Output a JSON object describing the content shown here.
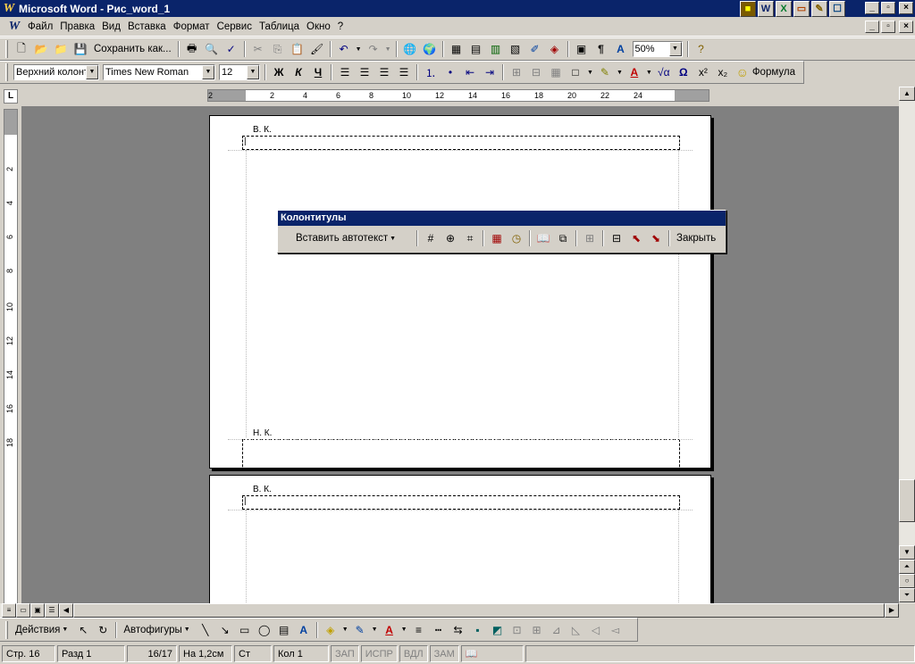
{
  "window": {
    "title": "Microsoft Word - Рис_word_1",
    "min": "_",
    "max": "🗗",
    "close": "×"
  },
  "tray": [
    {
      "name": "word-tray-icon",
      "glyph": "W"
    },
    {
      "name": "excel-tray-icon",
      "glyph": "X"
    },
    {
      "name": "powerpoint-tray-icon",
      "glyph": "▭"
    },
    {
      "name": "access-tray-icon",
      "glyph": "🔑"
    },
    {
      "name": "outlook-tray-icon",
      "glyph": "✉"
    }
  ],
  "menu": [
    "Файл",
    "Правка",
    "Вид",
    "Вставка",
    "Формат",
    "Сервис",
    "Таблица",
    "Окно",
    "?"
  ],
  "standard_toolbar": {
    "save_as_label": "Сохранить как...",
    "zoom": "50%"
  },
  "format_toolbar": {
    "style": "Верхний колонт",
    "font": "Times New Roman",
    "size": "12",
    "bold": "Ж",
    "italic": "К",
    "underline": "Ч",
    "omega": "Ω",
    "superscript": "x²",
    "subscript": "x₂",
    "formula_label": "Формула"
  },
  "ruler": {
    "h_labels": [
      "2",
      "2",
      "4",
      "6",
      "8",
      "10",
      "12",
      "14",
      "16",
      "18",
      "20",
      "22",
      "24"
    ],
    "v_labels": [
      "2",
      "4",
      "6",
      "8",
      "10",
      "12",
      "14",
      "16",
      "18"
    ]
  },
  "document": {
    "header_label": "В. К.",
    "footer_label": "Н. К."
  },
  "hf_toolbar": {
    "title": "Колонтитулы",
    "insert_autotext": "Вставить автотекст",
    "close": "Закрыть"
  },
  "draw_toolbar": {
    "actions": "Действия",
    "autoshapes": "Автофигуры"
  },
  "status": {
    "page": "Стр. 16",
    "section": "Разд 1",
    "pages": "16/17",
    "at": "На 1,2см",
    "line": "Ст",
    "col": "Кол 1",
    "rec": "ЗАП",
    "trk": "ИСПР",
    "ext": "ВДЛ",
    "ovr": "ЗАМ"
  },
  "colors": {
    "titlebar": "#0a246a",
    "chrome": "#d4d0c8",
    "workspace": "#808080"
  }
}
